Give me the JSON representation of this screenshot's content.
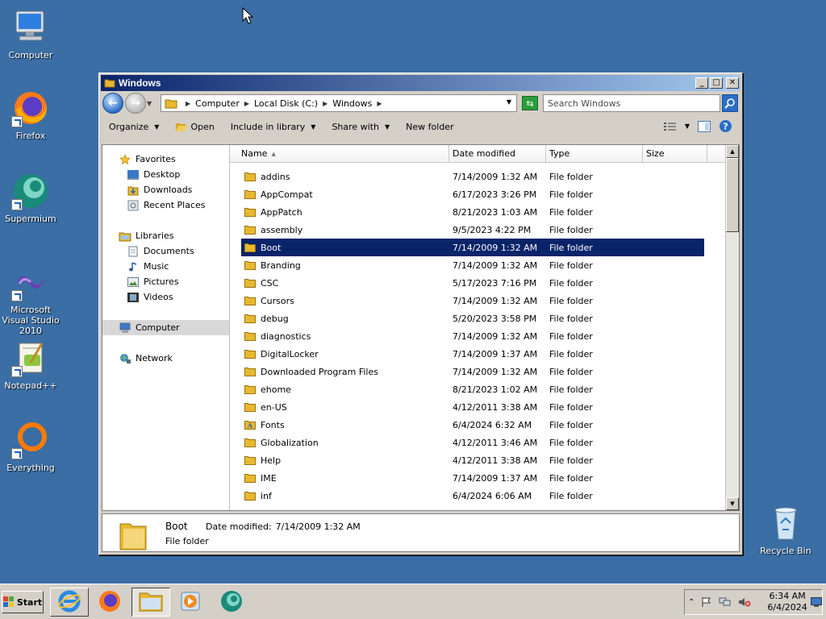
{
  "desktop": {
    "icons": [
      {
        "label": "Computer"
      },
      {
        "label": "Firefox"
      },
      {
        "label": "Supermium"
      },
      {
        "label": "Microsoft Visual Studio 2010"
      },
      {
        "label": "Notepad++"
      },
      {
        "label": "Everything"
      },
      {
        "label": "Recycle Bin"
      }
    ]
  },
  "window": {
    "title": "Windows",
    "address": {
      "crumbs": [
        "Computer",
        "Local Disk (C:)",
        "Windows"
      ]
    },
    "search": {
      "placeholder": "Search Windows"
    },
    "toolbar": {
      "organize": "Organize",
      "open": "Open",
      "include": "Include in library",
      "share": "Share with",
      "newfolder": "New folder"
    },
    "nav": {
      "favorites": "Favorites",
      "desktop": "Desktop",
      "downloads": "Downloads",
      "recent": "Recent Places",
      "libraries": "Libraries",
      "documents": "Documents",
      "music": "Music",
      "pictures": "Pictures",
      "videos": "Videos",
      "computer": "Computer",
      "network": "Network"
    },
    "columns": {
      "name": "Name",
      "date": "Date modified",
      "type": "Type",
      "size": "Size"
    },
    "files": [
      {
        "name": "addins",
        "date": "7/14/2009 1:32 AM",
        "type": "File folder"
      },
      {
        "name": "AppCompat",
        "date": "6/17/2023 3:26 PM",
        "type": "File folder"
      },
      {
        "name": "AppPatch",
        "date": "8/21/2023 1:03 AM",
        "type": "File folder"
      },
      {
        "name": "assembly",
        "date": "9/5/2023 4:22 PM",
        "type": "File folder"
      },
      {
        "name": "Boot",
        "date": "7/14/2009 1:32 AM",
        "type": "File folder"
      },
      {
        "name": "Branding",
        "date": "7/14/2009 1:32 AM",
        "type": "File folder"
      },
      {
        "name": "CSC",
        "date": "5/17/2023 7:16 PM",
        "type": "File folder"
      },
      {
        "name": "Cursors",
        "date": "7/14/2009 1:32 AM",
        "type": "File folder"
      },
      {
        "name": "debug",
        "date": "5/20/2023 3:58 PM",
        "type": "File folder"
      },
      {
        "name": "diagnostics",
        "date": "7/14/2009 1:32 AM",
        "type": "File folder"
      },
      {
        "name": "DigitalLocker",
        "date": "7/14/2009 1:37 AM",
        "type": "File folder"
      },
      {
        "name": "Downloaded Program Files",
        "date": "7/14/2009 1:32 AM",
        "type": "File folder"
      },
      {
        "name": "ehome",
        "date": "8/21/2023 1:02 AM",
        "type": "File folder"
      },
      {
        "name": "en-US",
        "date": "4/12/2011 3:38 AM",
        "type": "File folder"
      },
      {
        "name": "Fonts",
        "date": "6/4/2024 6:32 AM",
        "type": "File folder"
      },
      {
        "name": "Globalization",
        "date": "4/12/2011 3:46 AM",
        "type": "File folder"
      },
      {
        "name": "Help",
        "date": "4/12/2011 3:38 AM",
        "type": "File folder"
      },
      {
        "name": "IME",
        "date": "7/14/2009 1:37 AM",
        "type": "File folder"
      },
      {
        "name": "inf",
        "date": "6/4/2024 6:06 AM",
        "type": "File folder"
      }
    ],
    "details": {
      "name": "Boot",
      "date_label": "Date modified:",
      "date_value": "7/14/2009 1:32 AM",
      "type": "File folder"
    }
  },
  "taskbar": {
    "start": "Start",
    "clock_time": "6:34 AM",
    "clock_date": "6/4/2024"
  },
  "colors": {
    "desktop": "#3a6ea5",
    "titlebar_start": "#0a246a",
    "titlebar_end": "#a6caf0",
    "selection": "#0a246a",
    "folder": "#e8b830"
  }
}
